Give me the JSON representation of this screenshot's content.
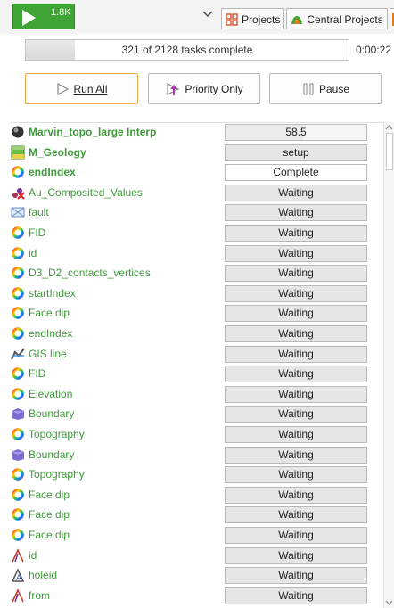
{
  "toolbar": {
    "run_count": "1.8K",
    "tabs": [
      {
        "label": "Projects",
        "icon": "projects-grid-icon"
      },
      {
        "label": "Central Projects",
        "icon": "central-projects-icon"
      }
    ]
  },
  "progress": {
    "text": "321 of 2128 tasks complete",
    "fraction": 0.151,
    "elapsed": "0:00:22"
  },
  "buttons": {
    "run_all": "Run All",
    "priority_only": "Priority Only",
    "pause": "Pause"
  },
  "tasks": [
    {
      "name": "Marvin_topo_large Interp",
      "status": "58.5",
      "icon": "interp-sphere-icon",
      "bold": true
    },
    {
      "name": "M_Geology",
      "status": "setup",
      "icon": "geology-model-icon",
      "bold": true
    },
    {
      "name": "endIndex",
      "status": "Complete",
      "icon": "ring-icon",
      "bold": true
    },
    {
      "name": "Au_Composited_Values",
      "status": "Waiting",
      "icon": "composite-values-icon",
      "bold": false
    },
    {
      "name": "fault",
      "status": "Waiting",
      "icon": "fault-icon",
      "bold": false
    },
    {
      "name": "FID",
      "status": "Waiting",
      "icon": "ring-icon",
      "bold": false
    },
    {
      "name": "id",
      "status": "Waiting",
      "icon": "ring-icon",
      "bold": false
    },
    {
      "name": "D3_D2_contacts_vertices",
      "status": "Waiting",
      "icon": "ring-icon",
      "bold": false
    },
    {
      "name": "startIndex",
      "status": "Waiting",
      "icon": "ring-icon",
      "bold": false
    },
    {
      "name": "Face dip",
      "status": "Waiting",
      "icon": "ring-icon",
      "bold": false
    },
    {
      "name": "endIndex",
      "status": "Waiting",
      "icon": "ring-icon",
      "bold": false
    },
    {
      "name": "GIS line",
      "status": "Waiting",
      "icon": "gis-line-icon",
      "bold": false
    },
    {
      "name": "FID",
      "status": "Waiting",
      "icon": "ring-icon",
      "bold": false
    },
    {
      "name": "Elevation",
      "status": "Waiting",
      "icon": "ring-icon",
      "bold": false
    },
    {
      "name": "Boundary",
      "status": "Waiting",
      "icon": "boundary-icon",
      "bold": false
    },
    {
      "name": "Topography",
      "status": "Waiting",
      "icon": "ring-icon",
      "bold": false
    },
    {
      "name": "Boundary",
      "status": "Waiting",
      "icon": "boundary-icon",
      "bold": false
    },
    {
      "name": "Topography",
      "status": "Waiting",
      "icon": "ring-icon",
      "bold": false
    },
    {
      "name": "Face dip",
      "status": "Waiting",
      "icon": "ring-icon",
      "bold": false
    },
    {
      "name": "Face dip",
      "status": "Waiting",
      "icon": "ring-icon",
      "bold": false
    },
    {
      "name": "Face dip",
      "status": "Waiting",
      "icon": "ring-icon",
      "bold": false
    },
    {
      "name": "id",
      "status": "Waiting",
      "icon": "drillhole-icon",
      "bold": false
    },
    {
      "name": "holeid",
      "status": "Waiting",
      "icon": "holeid-icon",
      "bold": false
    },
    {
      "name": "from",
      "status": "Waiting",
      "icon": "drillhole-icon",
      "bold": false
    }
  ]
}
